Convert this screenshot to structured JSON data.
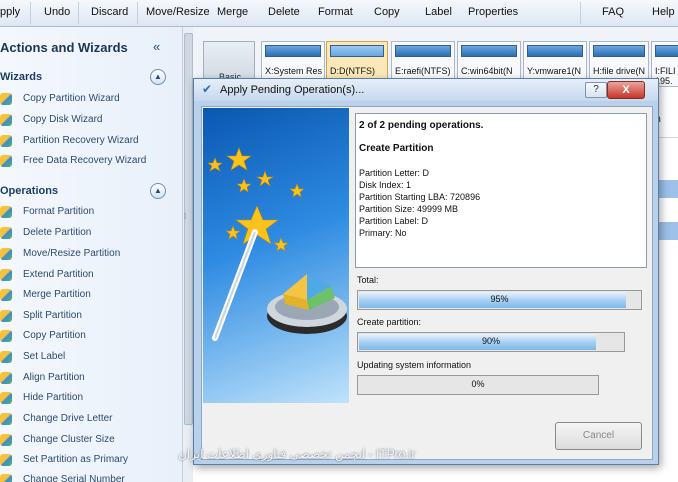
{
  "toolbar": {
    "items": [
      "pply",
      "Undo",
      "Discard",
      "Move/Resize",
      "Merge",
      "Delete",
      "Format",
      "Copy",
      "Label",
      "Properties",
      "FAQ",
      "Help"
    ]
  },
  "left_panel": {
    "title": "Actions and Wizards",
    "collapse_icon": "«",
    "wizards_title": "Wizards",
    "wizards": [
      "Copy Partition Wizard",
      "Copy Disk Wizard",
      "Partition Recovery Wizard",
      "Free Data Recovery Wizard"
    ],
    "operations_title": "Operations",
    "operations": [
      "Format Partition",
      "Delete Partition",
      "Move/Resize Partition",
      "Extend Partition",
      "Merge Partition",
      "Split Partition",
      "Copy Partition",
      "Set Label",
      "Align Partition",
      "Hide Partition",
      "Change Drive Letter",
      "Change Cluster Size",
      "Set Partition as Primary",
      "Change Serial Number"
    ],
    "section_icon": "chevron-up-icon"
  },
  "disk_map": {
    "disk_label": "Basic",
    "partitions": [
      "X:System Res",
      "D:D(NTFS)",
      "E:raefi(NTFS)",
      "C:win64bit(N",
      "Y:vmware1(N",
      "H:file drive(N",
      "I:FILI"
    ],
    "partial_text": "195.",
    "column_fragment": "em"
  },
  "dialog": {
    "title": "Apply Pending Operation(s)...",
    "help_label": "?",
    "close_label": "X",
    "info": {
      "summary": "2 of 2 pending operations.",
      "heading": "Create Partition",
      "lines": [
        "Partition Letter: D",
        "Disk Index: 1",
        "Partition Starting LBA: 720896",
        "Partition Size: 49999 MB",
        "Partition Label: D",
        "Primary: No"
      ]
    },
    "progress": [
      {
        "label": "Total:",
        "percent_text": "95%",
        "fraction": 0.95
      },
      {
        "label": "Create partition:",
        "percent_text": "90%",
        "fraction": 0.9
      },
      {
        "label": "Updating system information",
        "percent_text": "0%",
        "fraction": 0.0
      }
    ],
    "cancel_label": "Cancel"
  },
  "watermark": "انجمن تخصصی فناوری اطلاعات ایران - ITPro.ir",
  "colors": {
    "accent": "#2c6fb6",
    "progress": "#7db8ea",
    "close": "#c5362a"
  }
}
